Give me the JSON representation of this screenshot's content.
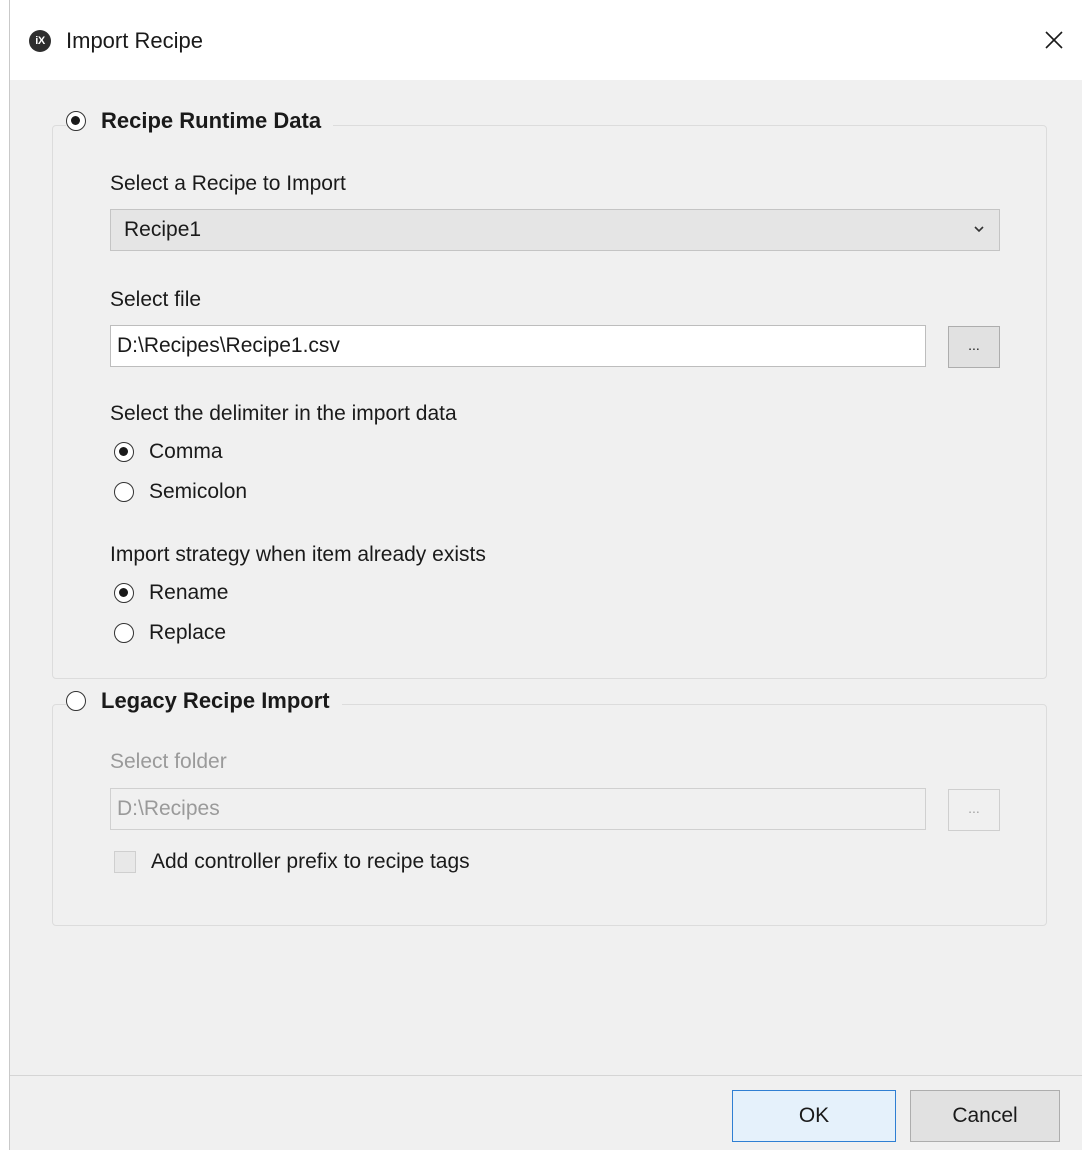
{
  "window": {
    "title": "Import Recipe",
    "icon_text": "iX"
  },
  "runtime_group": {
    "label": "Recipe Runtime Data",
    "selected": true,
    "recipe_label": "Select a Recipe to Import",
    "recipe_value": "Recipe1",
    "file_label": "Select file",
    "file_value": "D:\\Recipes\\Recipe1.csv",
    "browse_label": "...",
    "delimiter_label": "Select the delimiter in the import data",
    "delimiter_options": [
      {
        "label": "Comma",
        "checked": true
      },
      {
        "label": "Semicolon",
        "checked": false
      }
    ],
    "strategy_label": "Import strategy when item already exists",
    "strategy_options": [
      {
        "label": "Rename",
        "checked": true
      },
      {
        "label": "Replace",
        "checked": false
      }
    ]
  },
  "legacy_group": {
    "label": "Legacy Recipe Import",
    "selected": false,
    "folder_label": "Select folder",
    "folder_value": "D:\\Recipes",
    "browse_label": "...",
    "prefix_label": "Add controller prefix to recipe tags",
    "prefix_checked": false
  },
  "footer": {
    "ok_label": "OK",
    "cancel_label": "Cancel"
  }
}
